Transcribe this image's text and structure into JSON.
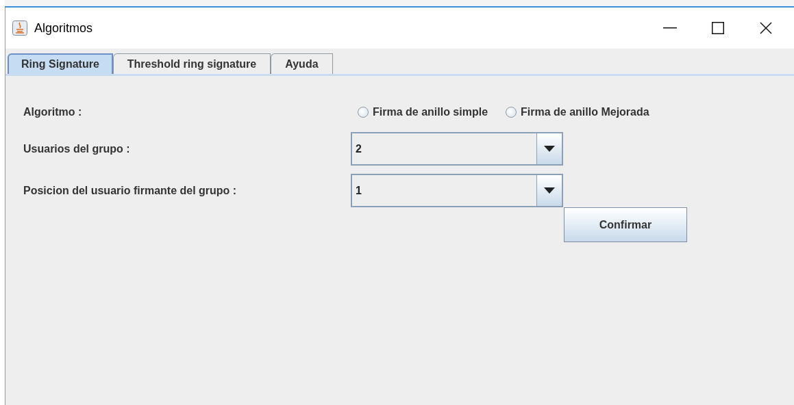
{
  "window": {
    "title": "Algoritmos"
  },
  "tabs": [
    {
      "label": "Ring Signature",
      "selected": true
    },
    {
      "label": "Threshold ring signature",
      "selected": false
    },
    {
      "label": "Ayuda",
      "selected": false
    }
  ],
  "form": {
    "algorithm_label": "Algoritmo :",
    "radios": [
      {
        "label": "Firma de anillo simple",
        "selected": false
      },
      {
        "label": "Firma de anillo Mejorada",
        "selected": false
      }
    ],
    "group_users_label": "Usuarios del grupo :",
    "group_users_value": "2",
    "signer_position_label": "Posicion del usuario firmante del grupo :",
    "signer_position_value": "1",
    "confirm_button": "Confirmar"
  }
}
